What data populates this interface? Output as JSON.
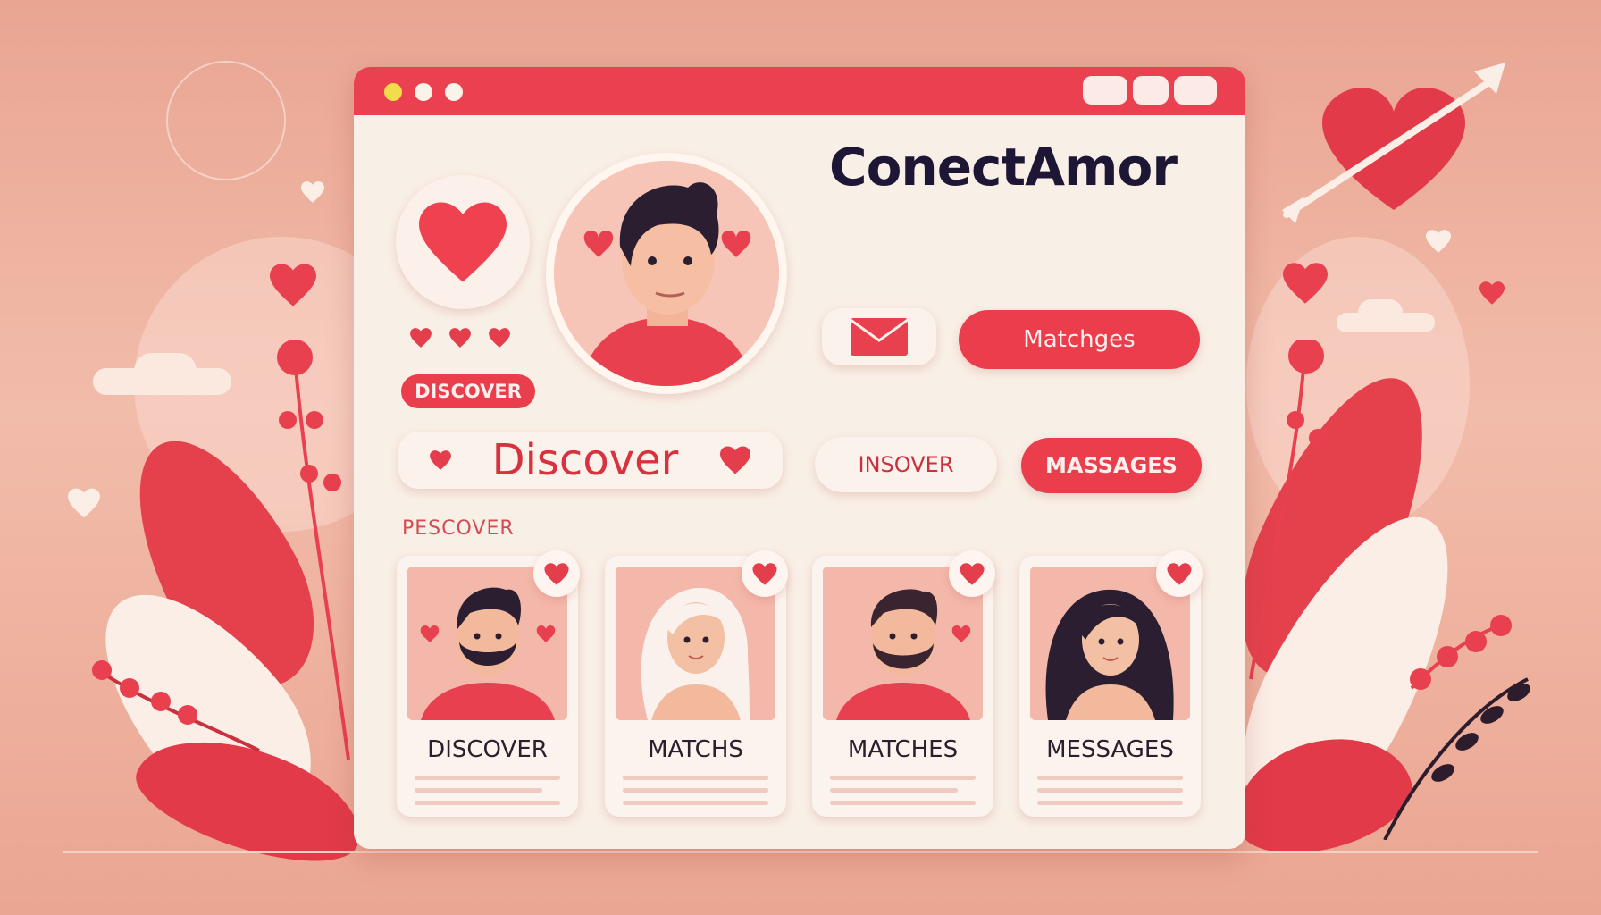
{
  "app": {
    "name": "ConectAmor",
    "title_bar_text": "",
    "tagline": ""
  },
  "titlebar_pills": [
    "",
    "",
    ""
  ],
  "buttons": {
    "matches": "Matchges",
    "inbox_icon": "envelope-icon",
    "insover": "INSOVER",
    "messages": "MASSAGES"
  },
  "discover_chip": "DISCOVER",
  "discover_pill": "Discover",
  "section_label": "PESCOVER",
  "cards": [
    {
      "label": "DISCOVER",
      "avatar": "bearded-man"
    },
    {
      "label": "MATCHS",
      "avatar": "blonde-woman"
    },
    {
      "label": "MATCHES",
      "avatar": "bearded-man-2"
    },
    {
      "label": "MESSAGES",
      "avatar": "dark-haired-woman"
    }
  ],
  "colors": {
    "accent": "#ea4050",
    "window_bg": "#f8efe6",
    "background": "#f2bcaa",
    "text_dark": "#1d1735"
  }
}
